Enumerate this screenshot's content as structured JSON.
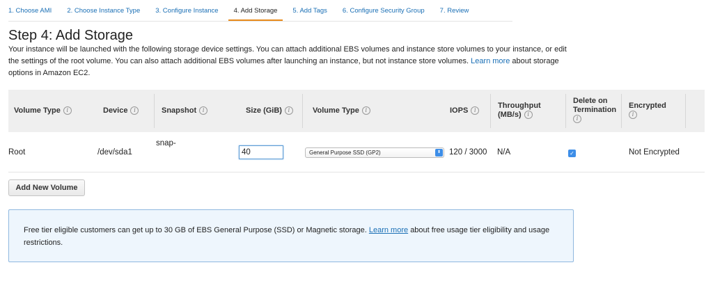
{
  "wizard": {
    "tabs": [
      {
        "label": "1. Choose AMI"
      },
      {
        "label": "2. Choose Instance Type"
      },
      {
        "label": "3. Configure Instance"
      },
      {
        "label": "4. Add Storage"
      },
      {
        "label": "5. Add Tags"
      },
      {
        "label": "6. Configure Security Group"
      },
      {
        "label": "7. Review"
      }
    ],
    "active_tab": "4. Add Storage"
  },
  "page": {
    "title": "Step 4: Add Storage",
    "description": "Your instance will be launched with the following storage device settings. You can attach additional EBS volumes and instance store volumes to your instance, or edit the settings of the root volume. You can also attach additional EBS volumes after launching an instance, but not instance store volumes.",
    "learn_more": "Learn more",
    "description_tail": "about storage options in Amazon EC2."
  },
  "table": {
    "headers": {
      "volume_type": "Volume Type",
      "device": "Device",
      "snapshot": "Snapshot",
      "size": "Size (GiB)",
      "ebs_volume_type": "Volume Type",
      "iops": "IOPS",
      "throughput_1": "Throughput",
      "throughput_2": "(MB/s)",
      "delete_1": "Delete on",
      "delete_2": "Termination",
      "encrypted": "Encrypted"
    },
    "info_glyph": "i",
    "row": {
      "volume_type": "Root",
      "device": "/dev/sda1",
      "snapshot": "snap-",
      "size": "40",
      "ebs_volume_type": "General Purpose SSD (GP2)",
      "iops": "120 / 3000",
      "throughput": "N/A",
      "delete_on_termination": true,
      "encrypted": "Not Encrypted"
    }
  },
  "actions": {
    "add_volume": "Add New Volume"
  },
  "notice": {
    "text": "Free tier eligible customers can get up to 30 GB of EBS General Purpose (SSD) or Magnetic storage.",
    "link": "Learn more",
    "text_tail": "about free usage tier eligibility and usage restrictions."
  },
  "colors": {
    "link": "#1a6fb5",
    "active_tab_underline": "#e88a1a",
    "control_blue": "#3d8ee8",
    "notice_bg": "#eef6fd",
    "notice_border": "#8fb8df"
  }
}
